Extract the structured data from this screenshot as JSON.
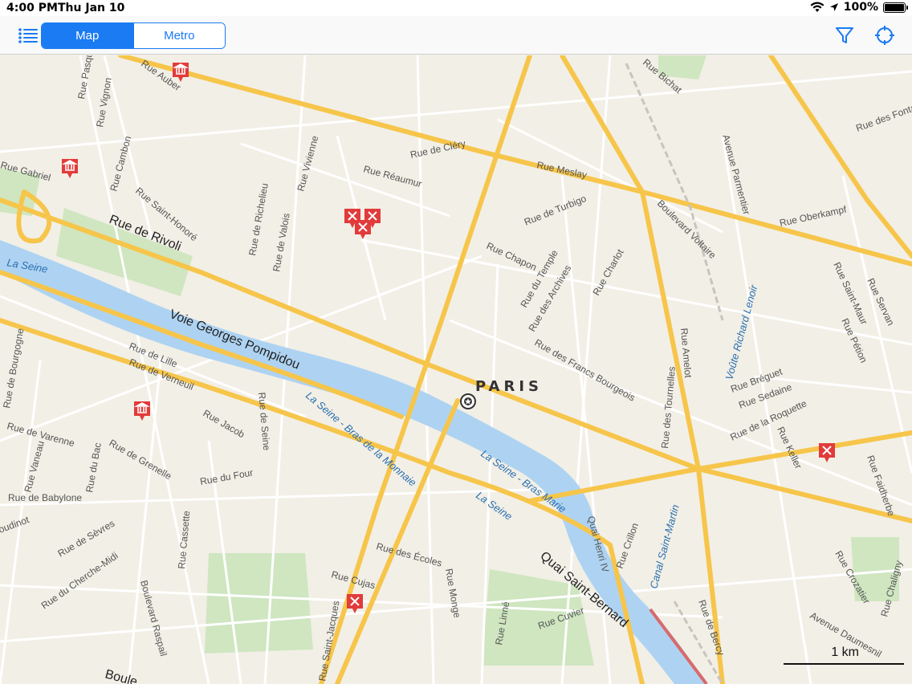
{
  "status": {
    "time": "4:00 PM",
    "date": "Thu Jan 10",
    "battery": "100%"
  },
  "toolbar": {
    "segments": [
      {
        "label": "Map",
        "active": true
      },
      {
        "label": "Metro",
        "active": false
      }
    ],
    "list_icon": "list-icon",
    "filter_icon": "filter-icon",
    "locate_icon": "crosshair-icon"
  },
  "map": {
    "city": "PARIS",
    "scale_label": "1 km",
    "colors": {
      "land": "#f2efe6",
      "water": "#aed3f2",
      "major_road": "#f6c54a",
      "minor_road": "#ffffff",
      "park": "#cfe6c0",
      "pin": "#e23b3b"
    },
    "streets": {
      "rivoli": "Rue de Rivoli",
      "pompidou": "Voie Georges Pompidou",
      "reaumur": "Rue Réaumur",
      "turbigo": "Rue de Turbigo",
      "meslay": "Rue Meslay",
      "clery": "Rue de Cléry",
      "oberkampf": "Rue Oberkampf",
      "voltaire": "Boulevard Voltaire",
      "parmentier": "Avenue Parmentier",
      "lenoir": "Voûte Richard Lenoir",
      "seine1": "La Seine",
      "seine2": "La Seine - Bras de la Monnaie",
      "seine3": "La Seine - Bras Marie",
      "seine4": "La Seine",
      "quai_henri": "Quai Henri IV",
      "quai_bernard": "Quai Saint-Bernard",
      "canal": "Canal Saint-Martin",
      "lille": "Rue de Lille",
      "verneuil": "Rue de Verneuil",
      "varenne": "Rue de Varenne",
      "grenelle": "Rue de Grenelle",
      "jacob": "Rue Jacob",
      "seine_rue": "Rue de Seine",
      "four": "Rue du Four",
      "babylone": "Rue de Babylone",
      "sevres": "Rue de Sèvres",
      "cherche_midi": "Rue du Cherche-Midi",
      "raspail": "Boulevard Raspail",
      "ecoles": "Rue des Écoles",
      "monge": "Rue Monge",
      "cujas": "Rue Cujas",
      "st_jacques": "Rue Saint-Jacques",
      "cuvier": "Rue Cuvier",
      "chapon": "Rue Chapon",
      "temple": "Rue du Temple",
      "archives": "Rue des Archives",
      "charlot": "Rue Charlot",
      "francs": "Rue des Francs Bourgeois",
      "tournelles": "Rue des Tournelles",
      "amelot": "Rue Amelot",
      "breguet": "Rue Bréguet",
      "sedaine": "Rue Sedaine",
      "roquette": "Rue de la Roquette",
      "keller": "Rue Keller",
      "st_maur": "Rue Saint-Maur",
      "servan": "Rue Servan",
      "petion": "Rue Pétion",
      "faidherbe": "Rue Faidherbe",
      "crozatier": "Rue Crozatier",
      "daumesnil": "Avenue Daumesnil",
      "chaligny": "Rue Chaligny",
      "bercy": "Rue de Bercy",
      "crillon": "Rue Crillon",
      "cambon": "Rue Cambon",
      "st_honore": "Rue Saint-Honoré",
      "richelieu": "Rue de Richelieu",
      "valois": "Rue de Valois",
      "vivienne": "Rue Vivienne",
      "gabriel": "Rue Gabriel",
      "vignon": "Rue Vignon",
      "auber": "Rue Auber",
      "pasquier": "Rue Pasquier",
      "bichat": "Rue Bichat",
      "fontaines": "Rue des Fontaines",
      "bourgogne": "Rue de Bourgogne",
      "vaneau": "Rue Vaneau",
      "bac": "Rue du Bac",
      "cassette": "Rue Cassette",
      "linne": "Rue Linné",
      "boul": "Boule",
      "boudinot": "oudinot"
    }
  }
}
